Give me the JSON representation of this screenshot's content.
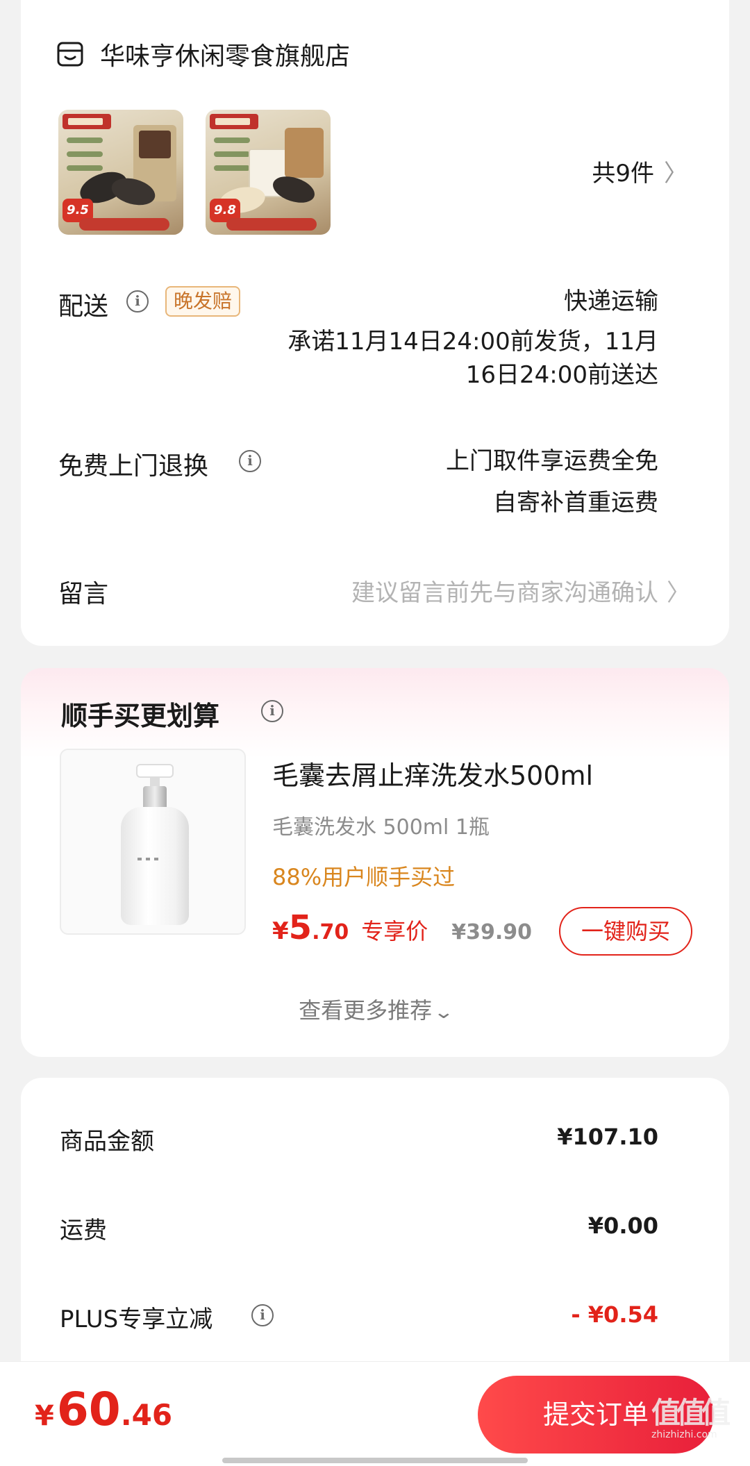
{
  "store": {
    "name": "华味亨休闲零食旗舰店",
    "thumbs": [
      {
        "price": "9.5"
      },
      {
        "price": "9.8"
      }
    ],
    "count_text": "共9件"
  },
  "delivery": {
    "label": "配送",
    "badge": "晚发赔",
    "method": "快递运输",
    "promise_line1": "承诺11月14日24:00前发货，11月",
    "promise_line2": "16日24:00前送达"
  },
  "returns": {
    "label": "免费上门退换",
    "line1": "上门取件享运费全免",
    "line2": "自寄补首重运费"
  },
  "message": {
    "label": "留言",
    "placeholder": "建议留言前先与商家沟通确认"
  },
  "recommend": {
    "title": "顺手买更划算",
    "product_name": "毛囊去屑止痒洗发水500ml",
    "spec": "毛囊洗发水 500ml 1瓶",
    "bought_text": "88%用户顺手买过",
    "price_currency": "¥",
    "price_int": "5",
    "price_dec": ".70",
    "exclusive_label": "专享价",
    "original_price": "¥39.90",
    "buy_button": "一键购买",
    "more_label": "查看更多推荐"
  },
  "summary": {
    "goods_label": "商品金额",
    "goods_value": "¥107.10",
    "shipping_label": "运费",
    "shipping_value": "¥0.00",
    "plus_label": "PLUS专享立减",
    "plus_value": "- ¥0.54"
  },
  "bottom": {
    "currency": "¥",
    "total_int": "60",
    "total_dec": ".46",
    "submit_label": "提交订单",
    "watermark_text": "值值值",
    "watermark_url": "zhizhizhi.com"
  },
  "colors": {
    "accent_red": "#e2231a",
    "bought_orange": "#d9861e",
    "badge_orange": "#c8742a"
  }
}
